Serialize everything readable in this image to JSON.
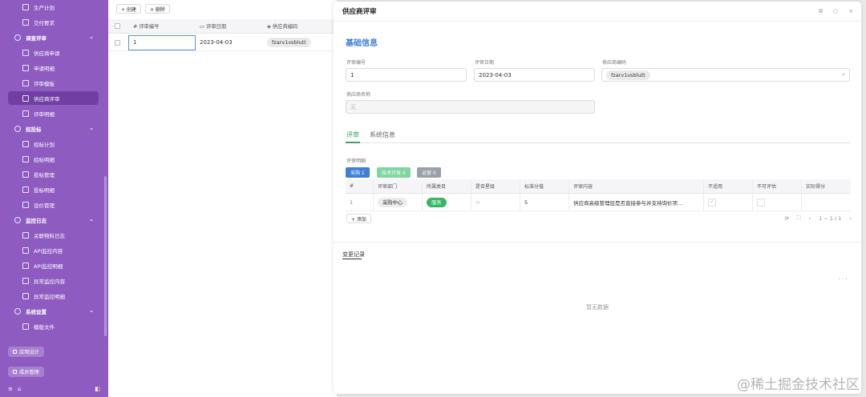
{
  "sidebar": {
    "items": [
      {
        "label": "生产计划",
        "type": "item"
      },
      {
        "label": "交付要求",
        "type": "item"
      },
      {
        "label": "调查评审",
        "type": "group",
        "chev": "⌄"
      },
      {
        "label": "供应商申请",
        "type": "item"
      },
      {
        "label": "申请明细",
        "type": "item"
      },
      {
        "label": "评审模板",
        "type": "item"
      },
      {
        "label": "供应商评审",
        "type": "item",
        "active": true
      },
      {
        "label": "评审明细",
        "type": "item"
      },
      {
        "label": "招投标",
        "type": "group",
        "chev": "⌄"
      },
      {
        "label": "招标计划",
        "type": "item"
      },
      {
        "label": "招标明细",
        "type": "item"
      },
      {
        "label": "投标管理",
        "type": "item"
      },
      {
        "label": "投标明细",
        "type": "item"
      },
      {
        "label": "设价管理",
        "type": "item"
      },
      {
        "label": "监控日志",
        "type": "group",
        "chev": "⌄"
      },
      {
        "label": "关联物料日志",
        "type": "item"
      },
      {
        "label": "API监控内容",
        "type": "item"
      },
      {
        "label": "API监控明细",
        "type": "item"
      },
      {
        "label": "异常监控内容",
        "type": "item"
      },
      {
        "label": "异常监控明细",
        "type": "item"
      },
      {
        "label": "系统设置",
        "type": "group",
        "chev": "⌄"
      },
      {
        "label": "模版文件",
        "type": "item"
      }
    ],
    "app_design": "应用设计",
    "member_mgmt": "成员管理",
    "bottom_icons": [
      "≡",
      "⌂",
      "◧"
    ]
  },
  "list": {
    "create_label": "+ 创建",
    "delete_label": "× 删除",
    "columns": [
      "# 评审编号",
      "▭ 评审日期",
      "◈ 供应商编码"
    ],
    "rows": [
      {
        "code": "1",
        "date": "2023-04-03",
        "supplier": "fzarv1vsblutt"
      }
    ]
  },
  "drawer": {
    "title": "供应商评审",
    "header_icons": [
      "⧉",
      "○",
      "×"
    ],
    "section_title": "基础信息",
    "fields": {
      "review_no_label": "评审编号",
      "review_no_value": "1",
      "review_date_label": "评审日期",
      "review_date_value": "2023-04-03",
      "supplier_code_label": "供应商编码",
      "supplier_code_value": "fzarv1vsblutt",
      "supplier_name_label": "供应商名称",
      "supplier_name_placeholder": "无"
    },
    "tabs": [
      "评审",
      "系统信息"
    ],
    "detail_label": "评审明细",
    "badges": [
      {
        "label": "采购 1",
        "color": "#3f7fd8"
      },
      {
        "label": "技术开发 0",
        "color": "#7fd6a0"
      },
      {
        "label": "运营 0",
        "color": "#9aa0aa"
      }
    ],
    "sub_columns": [
      "#",
      "评审部门",
      "所属类目",
      "是否星级",
      "标准分值",
      "评审内容",
      "不适用",
      "不可评估",
      "实际得分"
    ],
    "sub_rows": [
      {
        "idx": "1",
        "dept": "采购中心",
        "category": "服务",
        "star": "☆",
        "score": "5",
        "content": "供应商高级管理层是否直接参与并支持询价项…",
        "na": "✓"
      }
    ],
    "add_label": "+ 添加",
    "pager_text": "1 ~ 1 / 1",
    "pager_icons": [
      "⟳",
      "⛶",
      "‹",
      "›"
    ],
    "changes_title": "变更记录",
    "changes_nav": "‹ - ›",
    "empty_text": "暂无数据"
  },
  "watermark": "@稀土掘金技术社区"
}
